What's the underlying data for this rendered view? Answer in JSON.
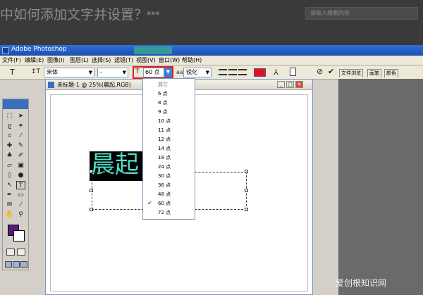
{
  "web": {
    "title": "中如何添加文字并设置？",
    "search_placeholder": "请输入搜索内容"
  },
  "app": {
    "title": "Adobe Photoshop"
  },
  "menu": [
    "文件(F)",
    "编辑(E)",
    "图像(I)",
    "图层(L)",
    "选择(S)",
    "滤镜(T)",
    "视图(V)",
    "窗口(W)",
    "帮助(H)"
  ],
  "options": {
    "font_family": "宋体",
    "font_style": "-",
    "font_size": "60 点",
    "antialias": "锐化",
    "text_color": "#e0102a"
  },
  "panel_tabs": [
    "文件浏览",
    "画笔",
    "颜色"
  ],
  "document": {
    "title": "未标题-1 @ 25%(晨起,RGB)",
    "text_layer_content": "晨起",
    "text_color": "#4ee0c8"
  },
  "size_dropdown": {
    "items": [
      "其它",
      "6 点",
      "8 点",
      "9 点",
      "10 点",
      "11 点",
      "12 点",
      "14 点",
      "18 点",
      "24 点",
      "30 点",
      "36 点",
      "48 点",
      "60 点",
      "72 点"
    ],
    "selected": "60 点"
  },
  "toolbox": {
    "foreground_color": "#5d1781",
    "background_color": "#ffffff"
  },
  "watermark": "爱创根知识网"
}
